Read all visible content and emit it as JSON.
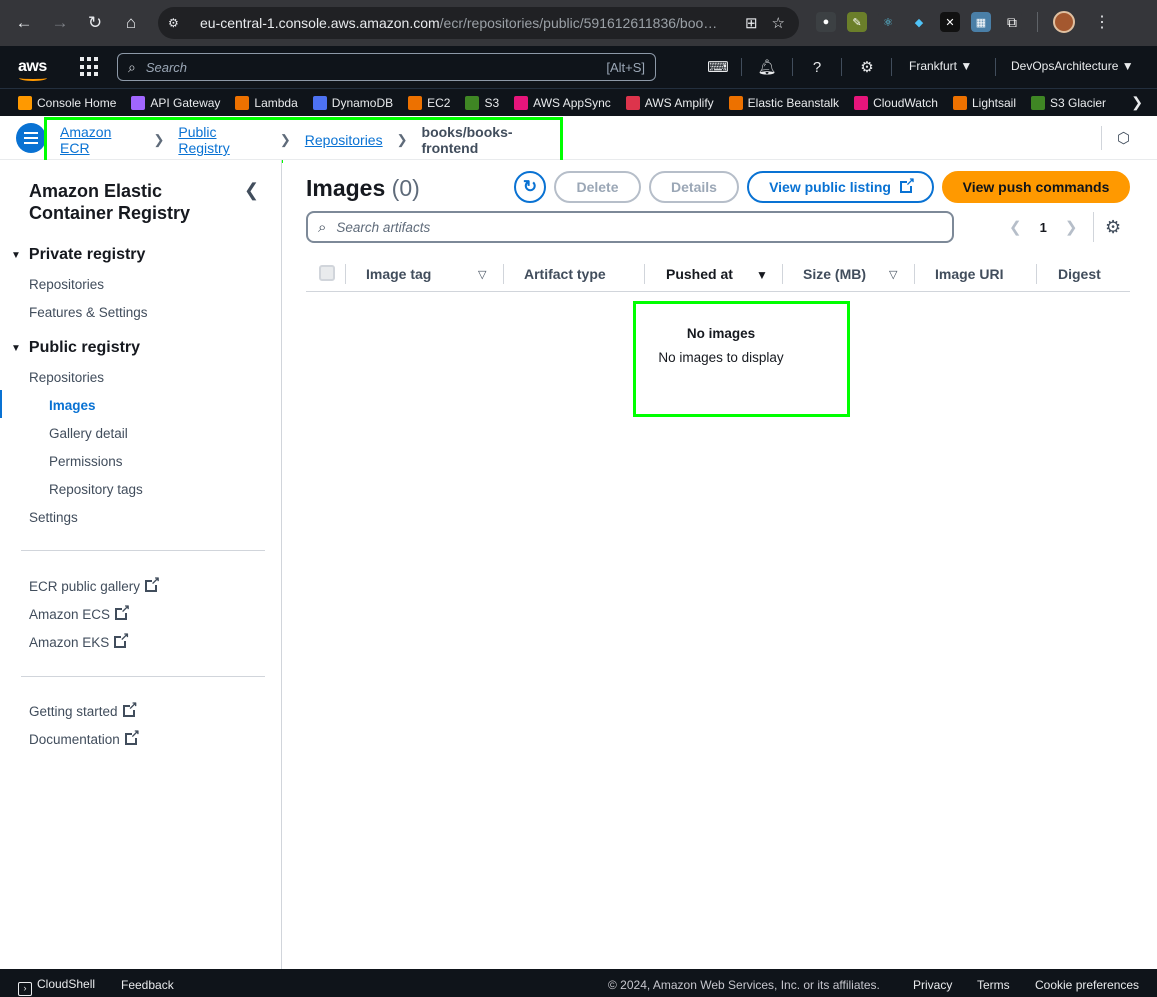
{
  "browser": {
    "url_host": "eu-central-1.console.aws.amazon.com",
    "url_path": "/ecr/repositories/public/591612611836/boo…"
  },
  "aws_nav": {
    "logo": "aws",
    "search_placeholder": "Search",
    "search_shortcut": "[Alt+S]",
    "region": "Frankfurt",
    "account": "DevOpsArchitecture"
  },
  "favorites": [
    {
      "label": "Console Home",
      "color": "#ff9900"
    },
    {
      "label": "API Gateway",
      "color": "#a166ff"
    },
    {
      "label": "Lambda",
      "color": "#ed7100"
    },
    {
      "label": "DynamoDB",
      "color": "#4d72f3"
    },
    {
      "label": "EC2",
      "color": "#ed7100"
    },
    {
      "label": "S3",
      "color": "#3f8624"
    },
    {
      "label": "AWS AppSync",
      "color": "#e7157b"
    },
    {
      "label": "AWS Amplify",
      "color": "#dd344c"
    },
    {
      "label": "Elastic Beanstalk",
      "color": "#ed7100"
    },
    {
      "label": "CloudWatch",
      "color": "#e7157b"
    },
    {
      "label": "Lightsail",
      "color": "#ed7100"
    },
    {
      "label": "S3 Glacier",
      "color": "#3f8624"
    }
  ],
  "breadcrumbs": {
    "items": [
      "Amazon ECR",
      "Public Registry",
      "Repositories"
    ],
    "current": "books/books-frontend"
  },
  "sidenav": {
    "title": "Amazon Elastic Container Registry",
    "private_heading": "Private registry",
    "private_items": [
      "Repositories",
      "Features & Settings"
    ],
    "public_heading": "Public registry",
    "public_repositories": "Repositories",
    "public_sub_items": [
      "Images",
      "Gallery detail",
      "Permissions",
      "Repository tags"
    ],
    "settings": "Settings",
    "external_links": [
      "ECR public gallery",
      "Amazon ECS",
      "Amazon EKS"
    ],
    "help_links": [
      "Getting started",
      "Documentation"
    ]
  },
  "main": {
    "title": "Images",
    "count": "(0)",
    "buttons": {
      "delete": "Delete",
      "details": "Details",
      "view_public": "View public listing",
      "push_commands": "View push commands"
    },
    "search_placeholder": "Search artifacts",
    "page_number": "1",
    "columns": [
      "Image tag",
      "Artifact type",
      "Pushed at",
      "Size (MB)",
      "Image URI",
      "Digest"
    ],
    "empty_title": "No images",
    "empty_subtitle": "No images to display"
  },
  "footer": {
    "cloudshell": "CloudShell",
    "feedback": "Feedback",
    "copyright": "© 2024, Amazon Web Services, Inc. or its affiliates.",
    "privacy": "Privacy",
    "terms": "Terms",
    "cookies": "Cookie preferences"
  }
}
